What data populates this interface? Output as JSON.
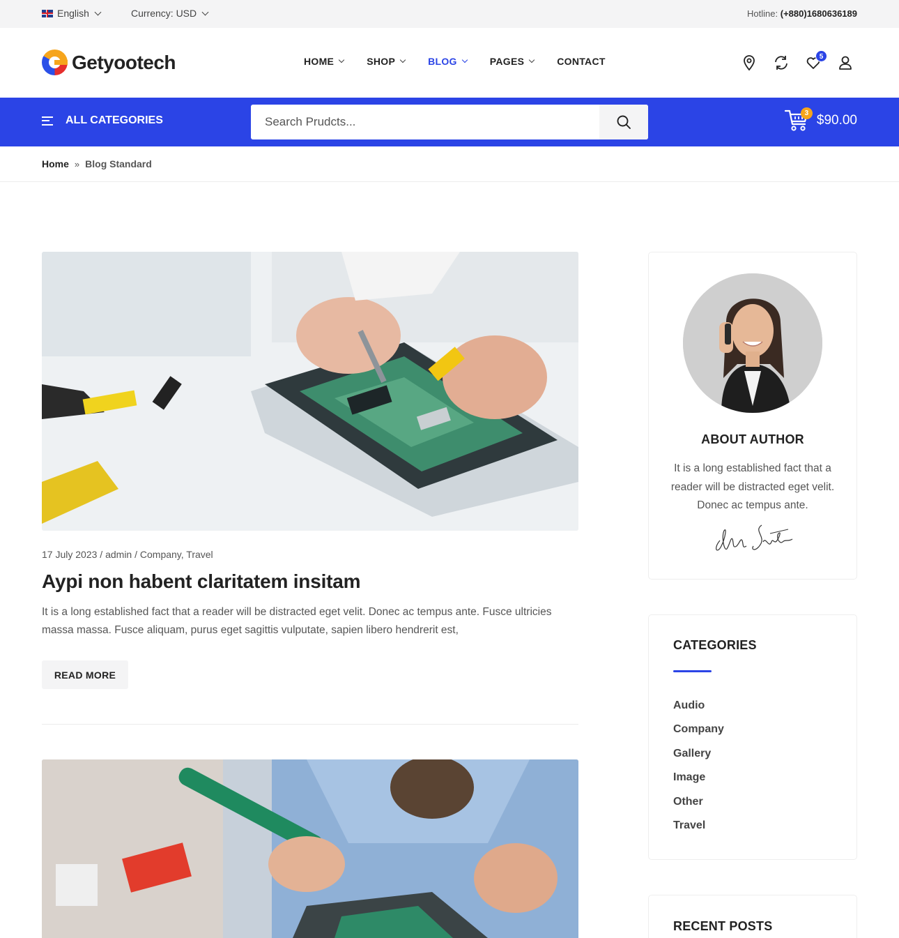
{
  "topbar": {
    "language": "English",
    "currency": "Currency: USD",
    "hotline_label": "Hotline:",
    "hotline_number": "(+880)1680636189"
  },
  "header": {
    "logo_text": "Getyootech",
    "nav": [
      {
        "label": "HOME",
        "dropdown": true
      },
      {
        "label": "SHOP",
        "dropdown": true
      },
      {
        "label": "BLOG",
        "dropdown": true,
        "active": true
      },
      {
        "label": "PAGES",
        "dropdown": true
      },
      {
        "label": "CONTACT",
        "dropdown": false
      }
    ],
    "icons": [
      "location-icon",
      "compare-icon",
      "wishlist-icon",
      "user-icon"
    ],
    "wishlist_count": "5"
  },
  "catbar": {
    "all_categories": "ALL CATEGORIES",
    "search_placeholder": "Search Prudcts...",
    "cart_count": "3",
    "cart_total": "$90.00"
  },
  "breadcrumb": {
    "home": "Home",
    "separator": "»",
    "current": "Blog Standard"
  },
  "posts": [
    {
      "date": "17 July 2023",
      "author": "admin",
      "categories": "Company, Travel",
      "title": "Aypi non habent claritatem insitam",
      "excerpt": "It is a long established fact that a reader will be distracted eget velit. Donec ac tempus ante. Fusce ultricies massa massa. Fusce aliquam, purus eget sagittis vulputate, sapien libero hendrerit est,",
      "read_more": "READ MORE"
    }
  ],
  "sidebar": {
    "author": {
      "title": "ABOUT AUTHOR",
      "text": "It is a long established fact that a reader will be distracted eget velit. Donec ac tempus ante.",
      "signature": "Author Signature"
    },
    "categories": {
      "title": "CATEGORIES",
      "items": [
        "Audio",
        "Company",
        "Gallery",
        "Image",
        "Other",
        "Travel"
      ]
    },
    "recent_posts": {
      "title": "RECENT POSTS"
    }
  },
  "colors": {
    "accent": "#2b44e6",
    "badge_orange": "#f6a51c",
    "topbar_bg": "#f4f4f5"
  }
}
